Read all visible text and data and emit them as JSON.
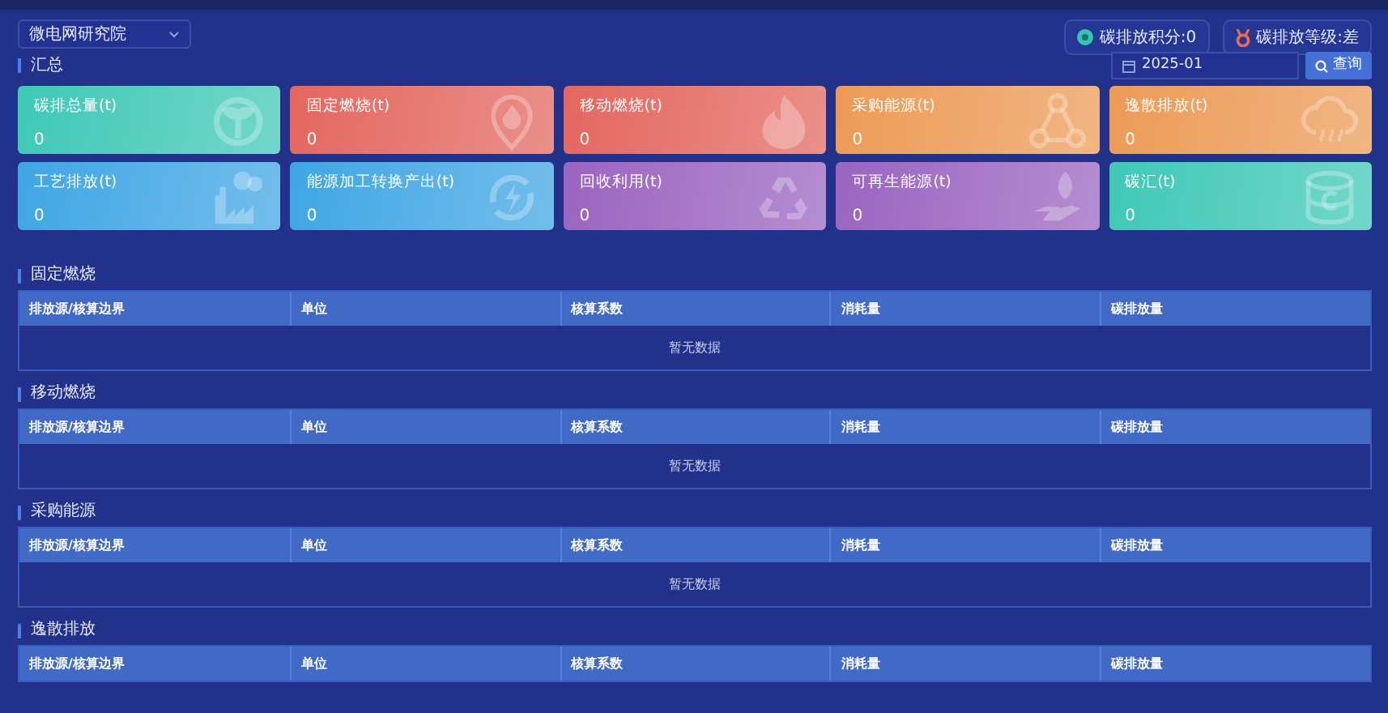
{
  "org_select": {
    "value": "微电网研究院"
  },
  "badges": [
    {
      "label": "碳排放积分:0"
    },
    {
      "label": "碳排放等级:差"
    }
  ],
  "summary": {
    "title": "汇总",
    "date": "2025-01",
    "query_button": "查询",
    "cards": [
      {
        "label": "碳排总量(t)",
        "value": "0",
        "color": "#3fc8b6"
      },
      {
        "label": "固定燃烧(t)",
        "value": "0",
        "color": "#e3675f"
      },
      {
        "label": "移动燃烧(t)",
        "value": "0",
        "color": "#e3675f"
      },
      {
        "label": "采购能源(t)",
        "value": "0",
        "color": "#ec9b56"
      },
      {
        "label": "逸散排放(t)",
        "value": "0",
        "color": "#ec9b56"
      },
      {
        "label": "工艺排放(t)",
        "value": "0",
        "color": "#3fa6e4"
      },
      {
        "label": "能源加工转换产出(t)",
        "value": "0",
        "color": "#3fa6e4"
      },
      {
        "label": "回收利用(t)",
        "value": "0",
        "color": "#9a64c0"
      },
      {
        "label": "可再生能源(t)",
        "value": "0",
        "color": "#9a64c0"
      },
      {
        "label": "碳汇(t)",
        "value": "0",
        "color": "#3fc8b6"
      }
    ]
  },
  "sections": [
    {
      "title": "固定燃烧",
      "columns": [
        "排放源/核算边界",
        "单位",
        "核算系数",
        "消耗量",
        "碳排放量"
      ],
      "empty_text": "暂无数据"
    },
    {
      "title": "移动燃烧",
      "columns": [
        "排放源/核算边界",
        "单位",
        "核算系数",
        "消耗量",
        "碳排放量"
      ],
      "empty_text": "暂无数据"
    },
    {
      "title": "采购能源",
      "columns": [
        "排放源/核算边界",
        "单位",
        "核算系数",
        "消耗量",
        "碳排放量"
      ],
      "empty_text": "暂无数据"
    },
    {
      "title": "逸散排放",
      "columns": [
        "排放源/核算边界",
        "单位",
        "核算系数",
        "消耗量",
        "碳排放量"
      ]
    }
  ]
}
